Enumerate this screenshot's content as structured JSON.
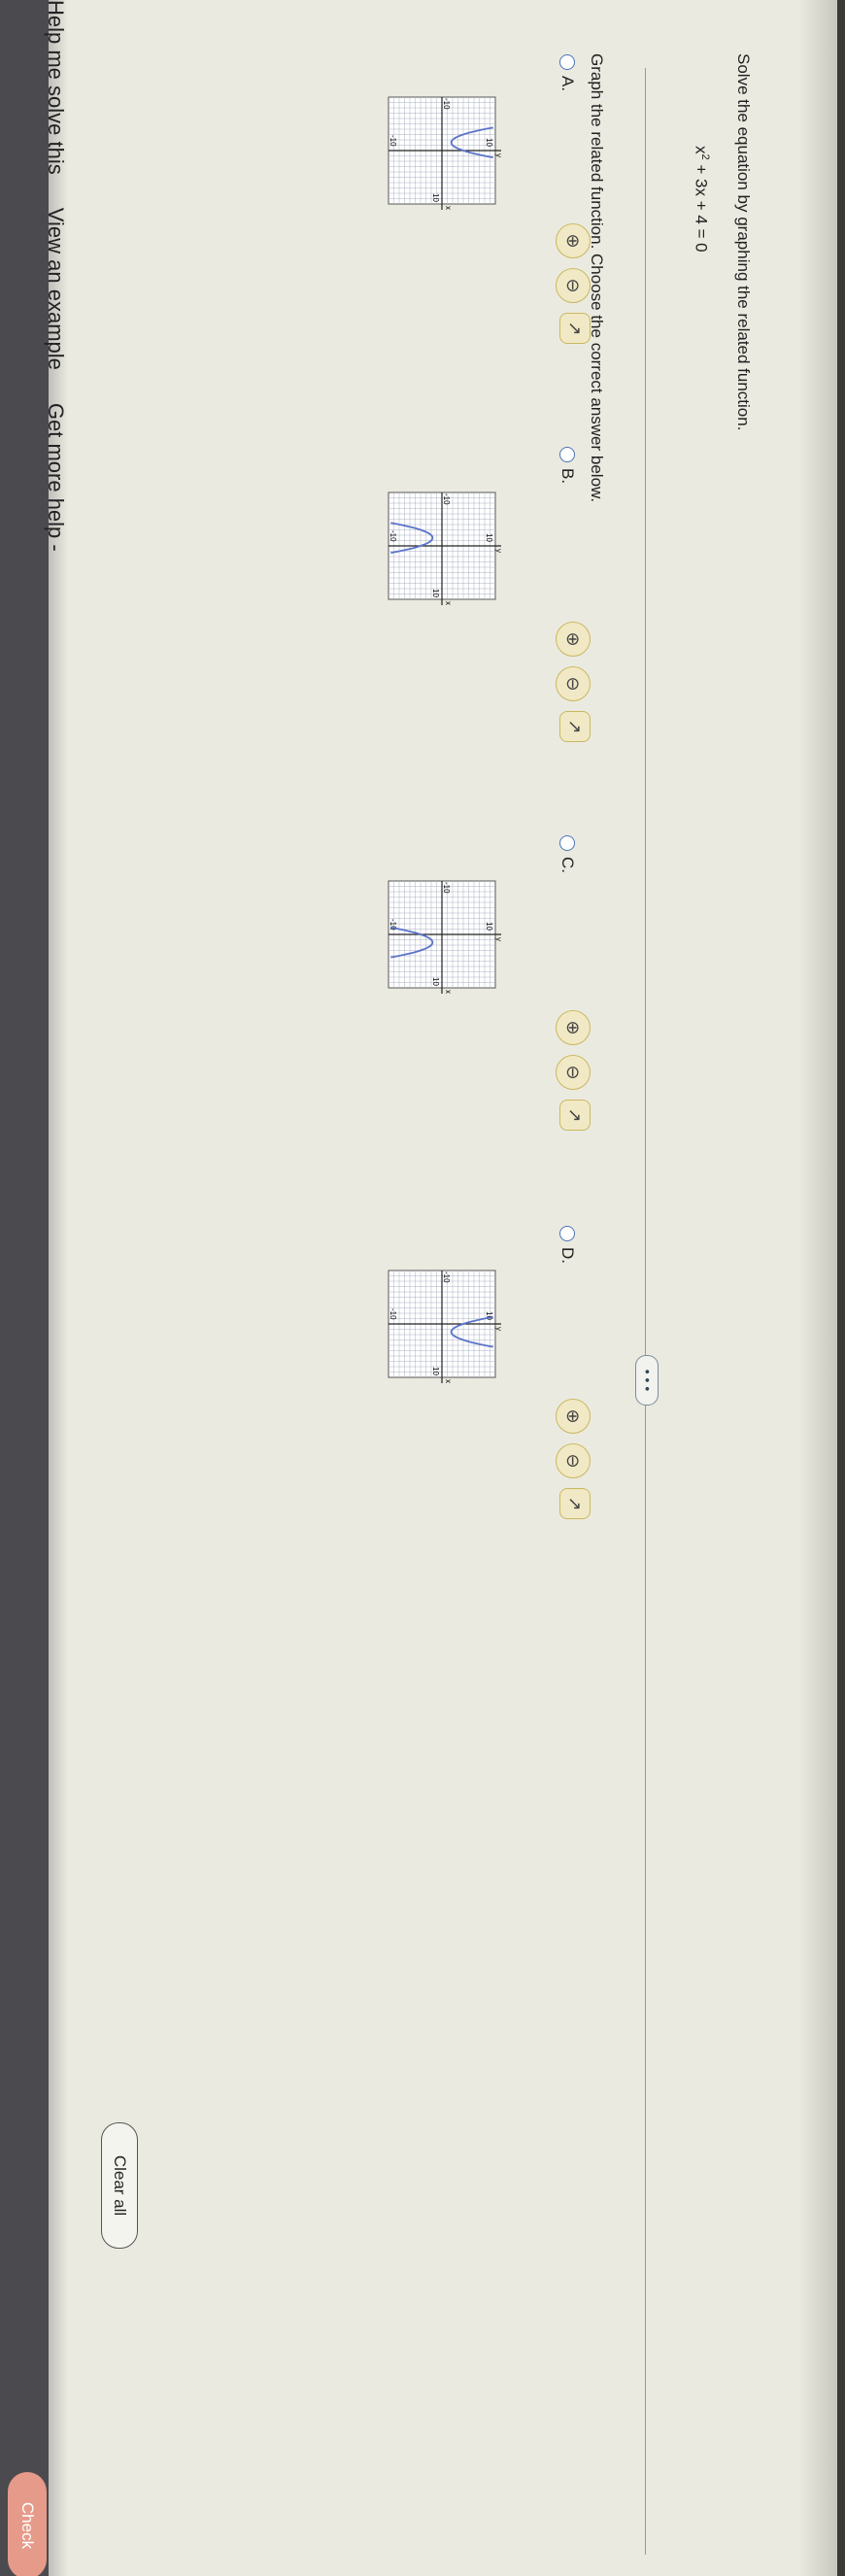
{
  "instruction": "Solve the equation by graphing the related function.",
  "equation": {
    "base": "x",
    "exp": "2",
    "rest": " + 3x + 4 = 0"
  },
  "more_dots": "• • •",
  "prompt": "Graph the related function. Choose the correct answer below.",
  "options": [
    {
      "label": "A.",
      "ticks": {
        "top": "10",
        "bottom": "-10",
        "left": "-10",
        "right": "10"
      },
      "axis": {
        "x": "x",
        "y": "y"
      }
    },
    {
      "label": "B.",
      "ticks": {
        "top": "10",
        "bottom": "-10",
        "left": "-10",
        "right": "10"
      },
      "axis": {
        "x": "x",
        "y": "y"
      }
    },
    {
      "label": "C.",
      "ticks": {
        "top": "10",
        "bottom": "-10",
        "left": "-10",
        "right": "10"
      },
      "axis": {
        "x": "x",
        "y": "y"
      }
    },
    {
      "label": "D.",
      "ticks": {
        "top": "10",
        "bottom": "-10",
        "left": "-10",
        "right": "10"
      },
      "axis": {
        "x": "x",
        "y": "y"
      }
    }
  ],
  "icon_names": [
    "zoom-in-icon",
    "zoom-out-icon",
    "popout-icon"
  ],
  "bottom_links": [
    "Help me solve this",
    "View an example",
    "Get more help -"
  ],
  "clear_all": "Clear all",
  "check": "Check",
  "colors": {
    "curve": "#5b74c9",
    "grid": "#aab0c2",
    "accent": "#e69a8a"
  }
}
